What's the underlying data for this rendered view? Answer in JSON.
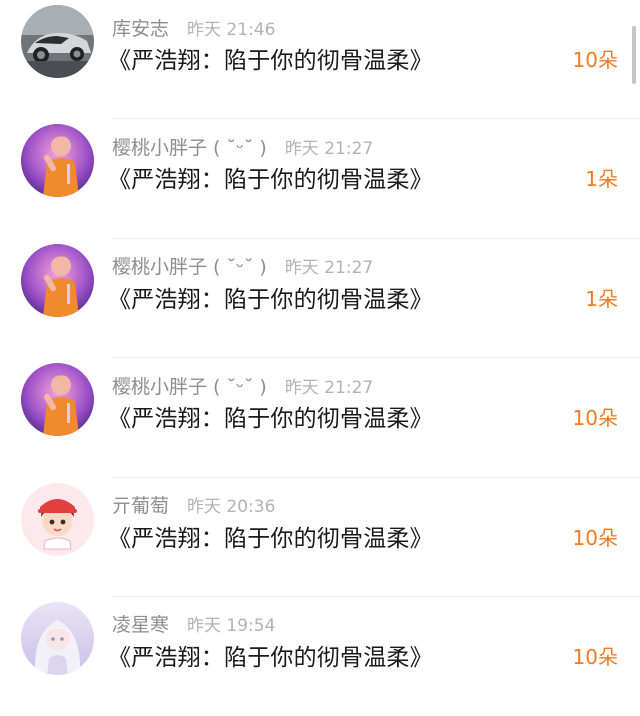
{
  "colors": {
    "username": "#8e8e8e",
    "time": "#b3b3b3",
    "title": "#1a1a1a",
    "count": "#f47b20",
    "divider": "#efefef"
  },
  "rows": [
    {
      "avatar": "car-avatar",
      "username": "库安志",
      "time": "昨天 21:46",
      "title": "《严浩翔：陷于你的彻骨温柔》",
      "count": "10朵"
    },
    {
      "avatar": "singer-avatar",
      "username": "樱桃小胖子 ( ˘ᵕ˘ )",
      "time": "昨天 21:27",
      "title": "《严浩翔：陷于你的彻骨温柔》",
      "count": "1朵"
    },
    {
      "avatar": "singer-avatar",
      "username": "樱桃小胖子 ( ˘ᵕ˘ )",
      "time": "昨天 21:27",
      "title": "《严浩翔：陷于你的彻骨温柔》",
      "count": "1朵"
    },
    {
      "avatar": "singer-avatar",
      "username": "樱桃小胖子 ( ˘ᵕ˘ )",
      "time": "昨天 21:27",
      "title": "《严浩翔：陷于你的彻骨温柔》",
      "count": "10朵"
    },
    {
      "avatar": "cartoon-boy-avatar",
      "username": "亓葡萄",
      "time": "昨天 20:36",
      "title": "《严浩翔：陷于你的彻骨温柔》",
      "count": "10朵"
    },
    {
      "avatar": "anime-girl-avatar",
      "username": "凌星寒",
      "time": "昨天 19:54",
      "title": "《严浩翔：陷于你的彻骨温柔》",
      "count": "10朵"
    }
  ]
}
